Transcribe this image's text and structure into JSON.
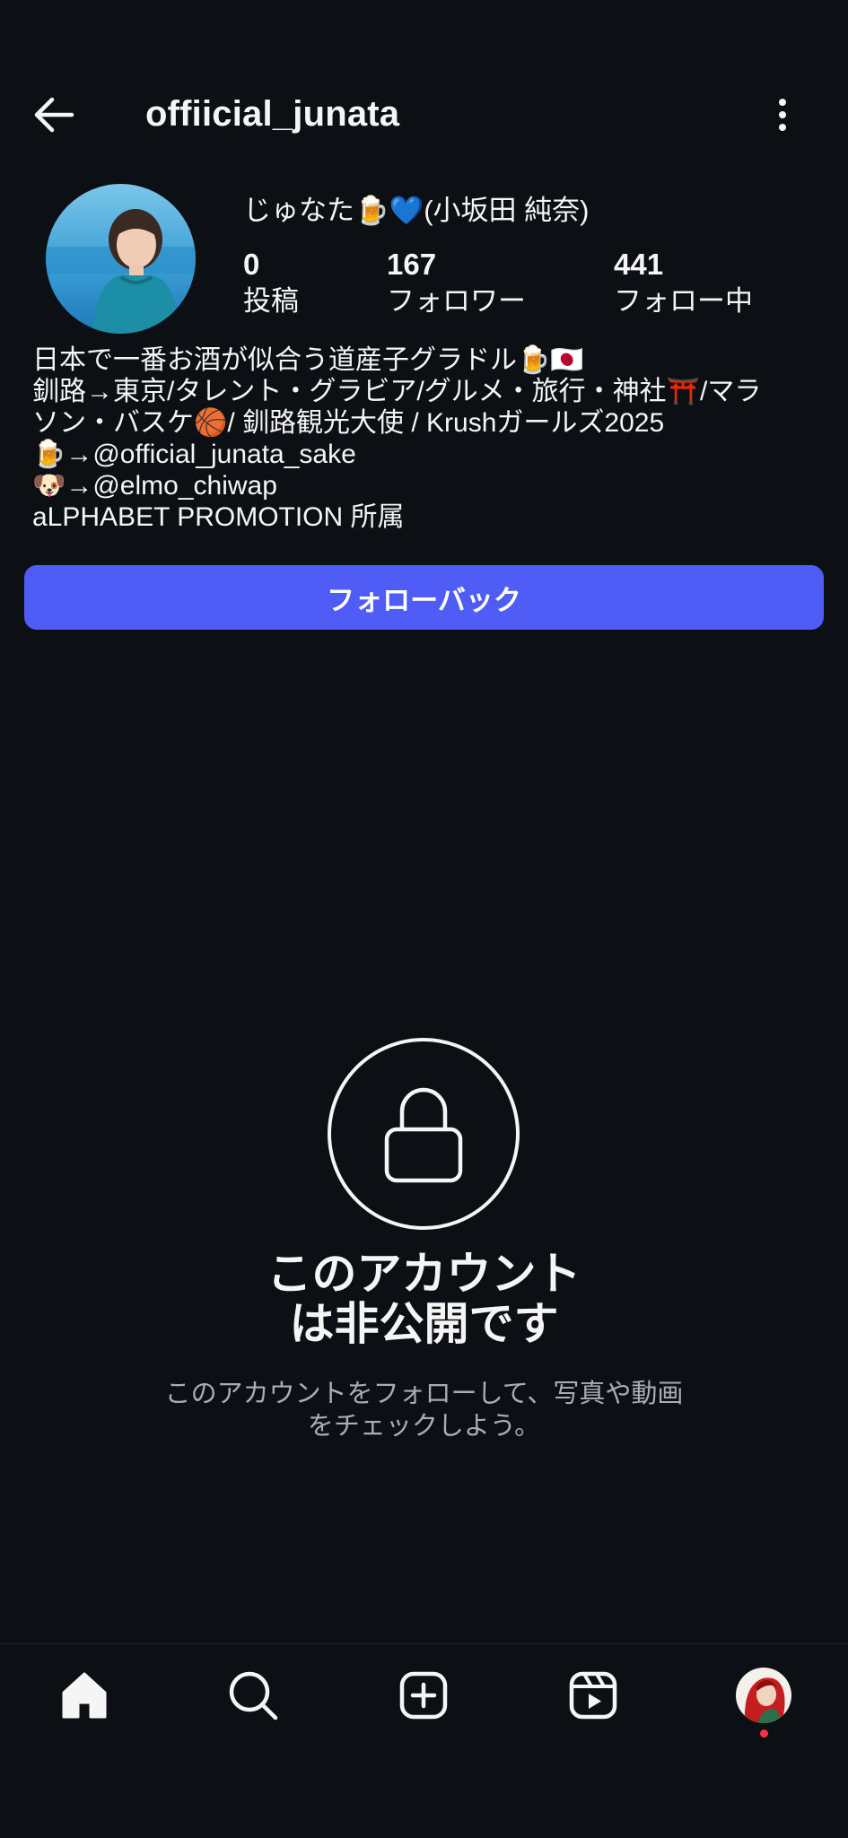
{
  "header": {
    "username": "offiicial_junata"
  },
  "profile": {
    "display_name": "じゅなた🍺💙(小坂田 純奈)",
    "stats": [
      {
        "value": "0",
        "label": "投稿"
      },
      {
        "value": "167",
        "label": "フォロワー"
      },
      {
        "value": "441",
        "label": "フォロー中"
      }
    ],
    "bio": [
      "日本で一番お酒が似合う道産子グラドル🍺🇯🇵",
      "釧路→東京/タレント・グラビア/グルメ・旅行・神社⛩️/マラ",
      "ソン・バスケ🏀/ 釧路観光大使 / Krushガールズ2025",
      "🍺→@official_junata_sake",
      "🐶→@elmo_chiwap",
      "aLPHABET PROMOTION 所属"
    ],
    "follow_button": "フォローバック"
  },
  "private": {
    "title_line1": "このアカウント",
    "title_line2": "は非公開です",
    "subtitle_line1": "このアカウントをフォローして、写真や動画",
    "subtitle_line2": "をチェックしよう。"
  },
  "nav": {
    "items": [
      "home-icon",
      "search-icon",
      "create-icon",
      "reels-icon",
      "profile-avatar"
    ]
  },
  "colors": {
    "background": "#0c1014",
    "accent": "#4f5cf5",
    "secondary_text": "#a8aeb6",
    "notification_dot": "#ff3040"
  }
}
